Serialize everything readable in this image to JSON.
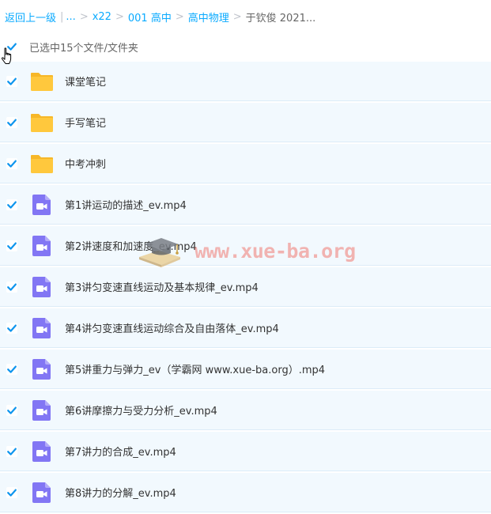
{
  "breadcrumb": {
    "back_label": "返回上一级",
    "ellipsis": "...",
    "items": [
      "x22",
      "001 高中",
      "高中物理"
    ],
    "current": "于钦俊 2021..."
  },
  "selection": {
    "label": "已选中15个文件/文件夹",
    "checked": true
  },
  "files": [
    {
      "name": "课堂笔记",
      "type": "folder",
      "checked": true
    },
    {
      "name": "手写笔记",
      "type": "folder",
      "checked": true
    },
    {
      "name": "中考冲刺",
      "type": "folder",
      "checked": true
    },
    {
      "name": "第1讲运动的描述_ev.mp4",
      "type": "video",
      "checked": true
    },
    {
      "name": "第2讲速度和加速度_ev.mp4",
      "type": "video",
      "checked": true
    },
    {
      "name": "第3讲匀变速直线运动及基本规律_ev.mp4",
      "type": "video",
      "checked": true
    },
    {
      "name": "第4讲匀变速直线运动综合及自由落体_ev.mp4",
      "type": "video",
      "checked": true
    },
    {
      "name": "第5讲重力与弹力_ev（学霸网 www.xue-ba.org）.mp4",
      "type": "video",
      "checked": true
    },
    {
      "name": "第6讲摩擦力与受力分析_ev.mp4",
      "type": "video",
      "checked": true
    },
    {
      "name": "第7讲力的合成_ev.mp4",
      "type": "video",
      "checked": true
    },
    {
      "name": "第8讲力的分解_ev.mp4",
      "type": "video",
      "checked": true
    }
  ],
  "watermark": {
    "text": "www.xue-ba.org",
    "icon": "graduation-cap-book-icon"
  },
  "colors": {
    "link": "#09aaff",
    "checkbox": "#0e95ee",
    "row_bg": "#f2f9fe",
    "folder": "#ffc83d",
    "video": "#8276f4"
  }
}
